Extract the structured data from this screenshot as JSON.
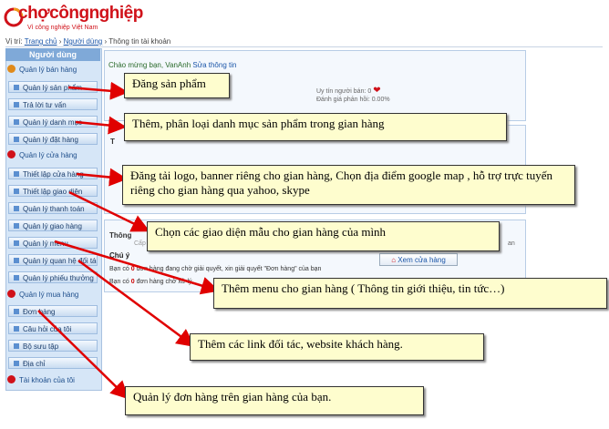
{
  "logo": {
    "name": "chợcôngnghiệp",
    "tagline": "Vì công nghiệp Việt Nam"
  },
  "breadcrumb": {
    "prefix": "Vị trí:",
    "items": [
      "Trang chủ",
      "Người dùng",
      "Thông tin tài khoản"
    ]
  },
  "sidebar": {
    "title": "Người dùng",
    "sections": [
      {
        "label": "Quản lý bán hàng",
        "color": "#e08a1a",
        "items": [
          "Quản lý sản phẩm",
          "Trả lời tư vấn",
          "Quản lý danh mục",
          "Quản lý đặt hàng"
        ]
      },
      {
        "label": "Quản lý cửa hàng",
        "color": "#d0121a",
        "items": [
          "Thiết lập cửa hàng",
          "Thiết lập giao diện",
          "Quản lý thanh toán",
          "Quản lý giao hàng",
          "Quản lý menu",
          "Quản lý quan hệ đối tác",
          "Quản lý phiếu thưởng"
        ]
      },
      {
        "label": "Quản lý mua hàng",
        "color": "#d0121a",
        "items": [
          "Đơn hàng",
          "Câu hỏi của tôi",
          "Bộ sưu tập",
          "Địa chỉ"
        ]
      },
      {
        "label": "Tài khoản của tôi",
        "color": "#d0121a",
        "items": []
      }
    ]
  },
  "main": {
    "welcome": "Chào mừng bạn, VanAnh",
    "edit_link": "Sửa thông tin",
    "seller_rating_label": "Uy tín người bán: 0",
    "feedback_label": "Đánh giá phản hồi: 0.00%",
    "panel2_heading": "T",
    "panel3_heading": "Thông",
    "panel3_sub": "Cấp",
    "panel3_right": "an",
    "note_label": "Chú ý",
    "note_line1_pre": "Bạn có",
    "note_line1_num": "0",
    "note_line1_post": "đơn hàng đang chờ giải quyết, xin giải quyết \"Đơn hàng\" của bạn",
    "note_line2_pre": "Bạn có",
    "note_line2_num": "0",
    "note_line2_post": "đơn hàng chờ xử lý",
    "shop_button": "Xem cửa hàng"
  },
  "callouts": [
    "Đăng sản phẩm",
    "Thêm, phân loại danh mục sản phẩm trong gian hàng",
    "Đăng tải logo, banner riêng cho gian hàng, Chọn địa điểm google map , hỗ trợ trực tuyến riêng cho gian hàng qua yahoo, skype",
    "Chọn các giao diện mẫu cho gian hàng của mình",
    "Thêm menu cho gian hàng ( Thông tin giới thiệu, tin tức…)",
    "Thêm các link đối tác, website khách hàng.",
    "Quản lý đơn hàng trên gian hàng của bạn."
  ],
  "colors": {
    "brand": "#d0121a",
    "sidebar_bg": "#d6e6f7",
    "callout_bg": "#fefdce",
    "arrow": "#e00000"
  }
}
